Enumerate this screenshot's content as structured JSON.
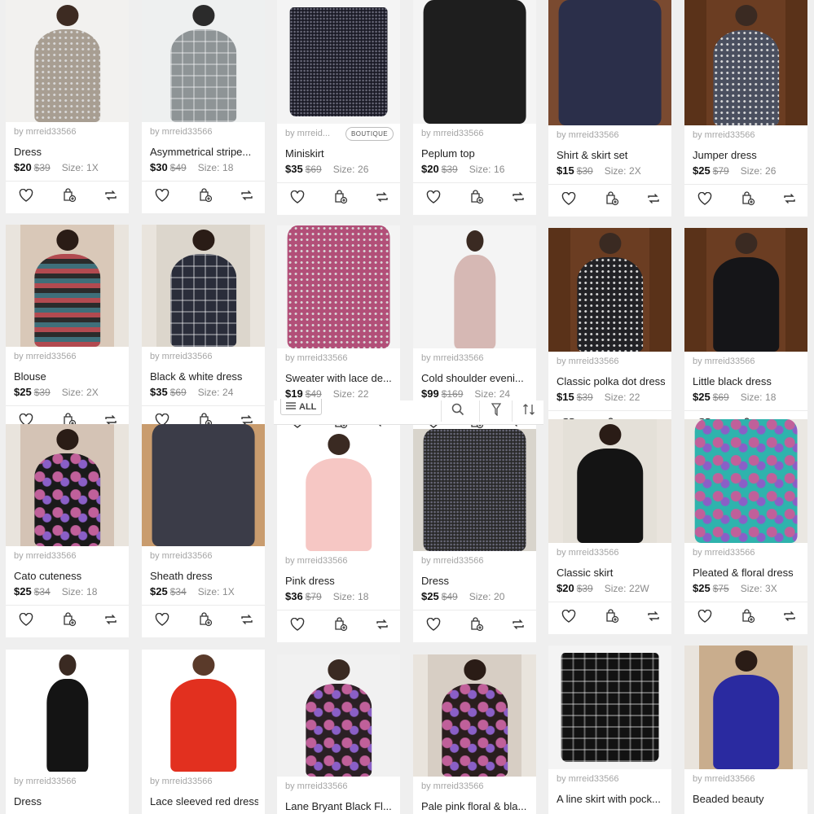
{
  "colors": {
    "accent": "#822432",
    "text": "#222222",
    "muted": "#a5a5a5"
  },
  "action_icons": [
    "heart-icon",
    "bundle-bag-icon",
    "share-icon"
  ],
  "filter_bar": {
    "all_label": "ALL",
    "icons": [
      "search-icon",
      "filter-icon",
      "sort-icon"
    ]
  },
  "listings": [
    {
      "seller": "by mrreid33566",
      "title": "Dress",
      "price": "$20",
      "original": "$39",
      "size_label": "Size:",
      "size": "1X"
    },
    {
      "seller": "by mrreid33566",
      "title": "Asymmetrical stripe...",
      "price": "$30",
      "original": "$49",
      "size_label": "Size:",
      "size": "18"
    },
    {
      "seller": "by mrreid...",
      "badge": "BOUTIQUE",
      "title": "Miniskirt",
      "price": "$35",
      "original": "$69",
      "size_label": "Size:",
      "size": "26"
    },
    {
      "seller": "by mrreid33566",
      "title": "Peplum top",
      "price": "$20",
      "original": "$39",
      "size_label": "Size:",
      "size": "16"
    },
    {
      "seller": "by mrreid33566",
      "title": "Shirt & skirt set",
      "price": "$15",
      "original": "$30",
      "size_label": "Size:",
      "size": "2X"
    },
    {
      "seller": "by mrreid33566",
      "title": "Jumper dress",
      "price": "$25",
      "original": "$79",
      "size_label": "Size:",
      "size": "26"
    },
    {
      "seller": "by mrreid33566",
      "title": "Blouse",
      "price": "$25",
      "original": "$39",
      "size_label": "Size:",
      "size": "2X"
    },
    {
      "seller": "by mrreid33566",
      "title": "Black & white dress",
      "price": "$35",
      "original": "$69",
      "size_label": "Size:",
      "size": "24"
    },
    {
      "seller": "by mrreid33566",
      "title": "Sweater with lace de...",
      "price": "$19",
      "original": "$49",
      "size_label": "Size:",
      "size": "22"
    },
    {
      "seller": "by mrreid33566",
      "title": "Cold shoulder eveni...",
      "price": "$99",
      "original": "$169",
      "size_label": "Size:",
      "size": "24"
    },
    {
      "seller": "by mrreid33566",
      "title": "Classic polka dot dress",
      "price": "$15",
      "original": "$39",
      "size_label": "Size:",
      "size": "22"
    },
    {
      "seller": "by mrreid33566",
      "title": "Little black dress",
      "price": "$25",
      "original": "$69",
      "size_label": "Size:",
      "size": "18"
    },
    {
      "seller": "by mrreid33566",
      "title": "Cato cuteness",
      "price": "$25",
      "original": "$34",
      "size_label": "Size:",
      "size": "18"
    },
    {
      "seller": "by mrreid33566",
      "title": "Sheath dress",
      "price": "$25",
      "original": "$34",
      "size_label": "Size:",
      "size": "1X"
    },
    {
      "seller": "by mrreid33566",
      "title": "Pink dress",
      "price": "$36",
      "original": "$79",
      "size_label": "Size:",
      "size": "18"
    },
    {
      "seller": "by mrreid33566",
      "title": "Dress",
      "price": "$25",
      "original": "$49",
      "size_label": "Size:",
      "size": "20"
    },
    {
      "seller": "by mrreid33566",
      "title": "Classic skirt",
      "price": "$20",
      "original": "$39",
      "size_label": "Size:",
      "size": "22W"
    },
    {
      "seller": "by mrreid33566",
      "title": "Pleated & floral dress",
      "price": "$25",
      "original": "$75",
      "size_label": "Size:",
      "size": "3X"
    },
    {
      "seller": "by mrreid33566",
      "title": "Dress"
    },
    {
      "seller": "by mrreid33566",
      "title": "Lace sleeved red dress"
    },
    {
      "seller": "by mrreid33566",
      "title": "Lane Bryant Black Fl..."
    },
    {
      "seller": "by mrreid33566",
      "title": "Pale pink floral & bla..."
    },
    {
      "seller": "by mrreid33566",
      "title": "A line skirt with pock..."
    },
    {
      "seller": "by mrreid33566",
      "title": "Beaded beauty"
    }
  ]
}
